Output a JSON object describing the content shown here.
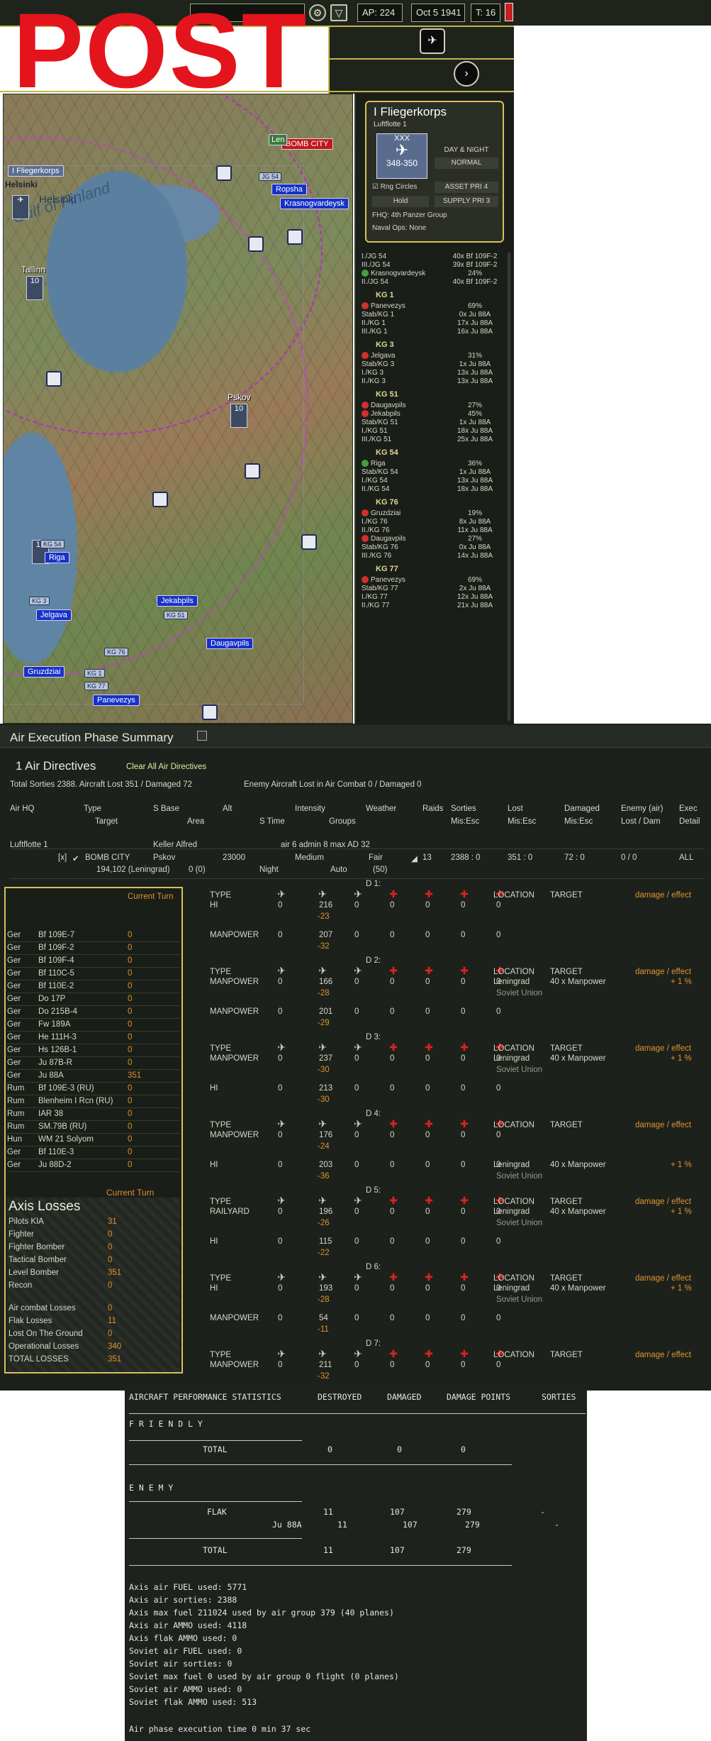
{
  "overlay": {
    "post": "POST"
  },
  "topbar": {
    "ap": "AP: 224",
    "date": "Oct 5 1941",
    "turn": "T: 16"
  },
  "map": {
    "cities": [
      "Helsinki",
      "Tallinn",
      "Pskov",
      "Riga",
      "Jelgava",
      "Jekabpils",
      "Daugavpils",
      "Gruzdziai",
      "Panevezys",
      "Ropsha",
      "Krasnogvardeysk"
    ],
    "target_label": "BOMB CITY",
    "hq_label": "I Fliegerkorps",
    "sea_label": "Gulf of Finland",
    "unit_tags": [
      "JG 54",
      "KG 54",
      "KG 3",
      "KG 51",
      "KG 76",
      "KG 1",
      "KG 77"
    ],
    "stack_values": [
      "10",
      "10",
      "10"
    ],
    "partial_label": "Len"
  },
  "hq_card": {
    "name": "I Fliegerkorps",
    "parent": "Luftflotte 1",
    "strength": "348-350",
    "mode": "DAY & NIGHT",
    "setting": "NORMAL",
    "rng": "Rng Circles",
    "asset": "ASSET PRI 4",
    "hold": "Hold",
    "supply": "SUPPLY PRI 3",
    "fhq": "FHQ: 4th Panzer Group",
    "naval": "Naval Ops: None"
  },
  "side_list": {
    "lines": [
      {
        "l": "I./JG 54",
        "r": "40x Bf 109F-2"
      },
      {
        "l": "III./JG 54",
        "r": "39x Bf 109F-2"
      },
      {
        "l": "Krasnogvardeysk",
        "r": "24%",
        "ck": "g"
      },
      {
        "l": "II./JG 54",
        "r": "40x Bf 109F-2"
      },
      {
        "g": "KG 1"
      },
      {
        "l": "Panevezys",
        "r": "69%",
        "ck": "r"
      },
      {
        "l": "Stab/KG 1",
        "r": "0x Ju 88A"
      },
      {
        "l": "II./KG 1",
        "r": "17x Ju 88A"
      },
      {
        "l": "III./KG 1",
        "r": "16x Ju 88A"
      },
      {
        "g": "KG 3"
      },
      {
        "l": "Jelgava",
        "r": "31%",
        "ck": "r"
      },
      {
        "l": "Stab/KG 3",
        "r": "1x Ju 88A"
      },
      {
        "l": "I./KG 3",
        "r": "13x Ju 88A"
      },
      {
        "l": "II./KG 3",
        "r": "13x Ju 88A"
      },
      {
        "g": "KG 51"
      },
      {
        "l": "Daugavpils",
        "r": "27%",
        "ck": "r"
      },
      {
        "l": "Jekabpils",
        "r": "45%",
        "ck": "r"
      },
      {
        "l": "Stab/KG 51",
        "r": "1x Ju 88A"
      },
      {
        "l": "I./KG 51",
        "r": "18x Ju 88A"
      },
      {
        "l": "III./KG 51",
        "r": "25x Ju 88A"
      },
      {
        "g": "KG 54"
      },
      {
        "l": "Riga",
        "r": "36%",
        "ck": "g"
      },
      {
        "l": "Stab/KG 54",
        "r": "1x Ju 88A"
      },
      {
        "l": "I./KG 54",
        "r": "13x Ju 88A"
      },
      {
        "l": "II./KG 54",
        "r": "18x Ju 88A"
      },
      {
        "g": "KG 76"
      },
      {
        "l": "Gruzdziai",
        "r": "19%",
        "ck": "r"
      },
      {
        "l": "I./KG 76",
        "r": "8x Ju 88A"
      },
      {
        "l": "II./KG 76",
        "r": "11x Ju 88A"
      },
      {
        "l": "Daugavpils",
        "r": "27%",
        "ck": "r"
      },
      {
        "l": "Stab/KG 76",
        "r": "0x Ju 88A"
      },
      {
        "l": "III./KG 76",
        "r": "14x Ju 88A"
      },
      {
        "g": "KG 77"
      },
      {
        "l": "Panevezys",
        "r": "69%",
        "ck": "r"
      },
      {
        "l": "Stab/KG 77",
        "r": "2x Ju 88A"
      },
      {
        "l": "I./KG 77",
        "r": "12x Ju 88A"
      },
      {
        "l": "II./KG 77",
        "r": "21x Ju 88A"
      }
    ]
  },
  "summary": {
    "title": "Air Execution Phase Summary",
    "directives": "1 Air Directives",
    "clear_all": "Clear All Air Directives",
    "totals": "Total Sorties 2388. Aircraft Lost 351 / Damaged 72",
    "enemy_lost": "Enemy Aircraft Lost in Air Combat 0 / Damaged 0",
    "col_headers": [
      "Air HQ",
      "Type",
      "S Base",
      "Alt",
      "Intensity",
      "Weather",
      "Raids",
      "Sorties",
      "Lost",
      "Damaged",
      "Enemy (air)",
      "Exec"
    ],
    "col_sub": [
      "Target",
      "Area",
      "S Time",
      "Groups",
      "Mis:Esc",
      "Mis:Esc",
      "Mis:Esc",
      "Lost / Dam",
      "Detail"
    ],
    "hq_row": {
      "name": "Luftflotte 1",
      "commander": "Keller Alfred",
      "stats": "air 6   admin 8   max AD 32"
    },
    "directive_row": {
      "check": "[x]",
      "type": "BOMB CITY",
      "base": "Pskov",
      "alt": "23000",
      "intensity": "Medium",
      "weather": "Fair",
      "raids": "13",
      "sorties": "2388 : 0",
      "lost": "351 : 0",
      "damaged": "72 : 0",
      "enemy": "0 / 0",
      "detail": "ALL",
      "target": "194,102 (Leningrad)",
      "area": "0 (0)",
      "time": "Night",
      "groups": "Auto",
      "groups_n": "(50)"
    }
  },
  "losses_panel": {
    "current_turn": "Current Turn",
    "rows": [
      {
        "n": "Ger",
        "t": "Bf 109E-7",
        "v": "0"
      },
      {
        "n": "Ger",
        "t": "Bf 109F-2",
        "v": "0"
      },
      {
        "n": "Ger",
        "t": "Bf 109F-4",
        "v": "0"
      },
      {
        "n": "Ger",
        "t": "Bf 110C-5",
        "v": "0"
      },
      {
        "n": "Ger",
        "t": "Bf 110E-2",
        "v": "0"
      },
      {
        "n": "Ger",
        "t": "Do 17P",
        "v": "0"
      },
      {
        "n": "Ger",
        "t": "Do 215B-4",
        "v": "0"
      },
      {
        "n": "Ger",
        "t": "Fw 189A",
        "v": "0"
      },
      {
        "n": "Ger",
        "t": "He 111H-3",
        "v": "0"
      },
      {
        "n": "Ger",
        "t": "Hs 126B-1",
        "v": "0"
      },
      {
        "n": "Ger",
        "t": "Ju 87B-R",
        "v": "0"
      },
      {
        "n": "Ger",
        "t": "Ju 88A",
        "v": "351"
      },
      {
        "n": "Rum",
        "t": "Bf 109E-3 (RU)",
        "v": "0"
      },
      {
        "n": "Rum",
        "t": "Blenheim I Rcn (RU)",
        "v": "0"
      },
      {
        "n": "Rum",
        "t": "IAR 38",
        "v": "0"
      },
      {
        "n": "Rum",
        "t": "SM.79B (RU)",
        "v": "0"
      },
      {
        "n": "Hun",
        "t": "WM 21 Solyom",
        "v": "0"
      },
      {
        "n": "Ger",
        "t": "Bf 110E-3",
        "v": "0"
      },
      {
        "n": "Ger",
        "t": "Ju 88D-2",
        "v": "0"
      }
    ],
    "axis_title": "Axis Losses",
    "axis_current": "Current Turn",
    "axis_rows": [
      {
        "k": "Pilots KIA",
        "v": "31"
      },
      {
        "k": "Fighter",
        "v": "0"
      },
      {
        "k": "Fighter Bomber",
        "v": "0"
      },
      {
        "k": "Tactical Bomber",
        "v": "0"
      },
      {
        "k": "Level Bomber",
        "v": "351"
      },
      {
        "k": "Recon",
        "v": "0"
      }
    ],
    "axis_rows2": [
      {
        "k": "Air combat Losses",
        "v": "0"
      },
      {
        "k": "Flak Losses",
        "v": "11"
      },
      {
        "k": "Lost On The Ground",
        "v": "0"
      },
      {
        "k": "Operational Losses",
        "v": "340"
      },
      {
        "k": "TOTAL LOSSES",
        "v": "351"
      }
    ]
  },
  "days": [
    {
      "d": "D 1:",
      "rows": [
        {
          "type": "HI",
          "v": [
            "0",
            "216",
            "0",
            "0",
            "0",
            "0",
            "0"
          ],
          "delta": "-23",
          "loc": "",
          "tgt": "",
          "eff": ""
        },
        {
          "type": "MANPOWER",
          "v": [
            "0",
            "207",
            "0",
            "0",
            "0",
            "0",
            "0"
          ],
          "delta": "-32",
          "loc": "",
          "tgt": "",
          "eff": ""
        }
      ]
    },
    {
      "d": "D 2:",
      "rows": [
        {
          "type": "MANPOWER",
          "v": [
            "0",
            "166",
            "0",
            "0",
            "0",
            "0",
            "0"
          ],
          "delta": "-28",
          "loc": "Leningrad",
          "tgt": "40 x Manpower",
          "eff": "+ 1 %",
          "country": "Soviet Union"
        },
        {
          "type": "MANPOWER",
          "v": [
            "0",
            "201",
            "0",
            "0",
            "0",
            "0",
            "0"
          ],
          "delta": "-29",
          "loc": "",
          "tgt": "",
          "eff": ""
        }
      ]
    },
    {
      "d": "D 3:",
      "rows": [
        {
          "type": "MANPOWER",
          "v": [
            "0",
            "237",
            "0",
            "0",
            "0",
            "0",
            "0"
          ],
          "delta": "-30",
          "loc": "Leningrad",
          "tgt": "40 x Manpower",
          "eff": "+ 1 %",
          "country": "Soviet Union"
        },
        {
          "type": "HI",
          "v": [
            "0",
            "213",
            "0",
            "0",
            "0",
            "0",
            "0"
          ],
          "delta": "-30",
          "loc": "",
          "tgt": "",
          "eff": ""
        }
      ]
    },
    {
      "d": "D 4:",
      "rows": [
        {
          "type": "MANPOWER",
          "v": [
            "0",
            "176",
            "0",
            "0",
            "0",
            "0",
            "0"
          ],
          "delta": "-24",
          "loc": "",
          "tgt": "",
          "eff": ""
        },
        {
          "type": "HI",
          "v": [
            "0",
            "203",
            "0",
            "0",
            "0",
            "0",
            "0"
          ],
          "delta": "-36",
          "loc": "Leningrad",
          "tgt": "40 x Manpower",
          "eff": "+ 1 %",
          "country": "Soviet Union"
        }
      ]
    },
    {
      "d": "D 5:",
      "rows": [
        {
          "type": "RAILYARD",
          "v": [
            "0",
            "196",
            "0",
            "0",
            "0",
            "0",
            "0"
          ],
          "delta": "-26",
          "loc": "Leningrad",
          "tgt": "40 x Manpower",
          "eff": "+ 1 %",
          "country": "Soviet Union"
        },
        {
          "type": "HI",
          "v": [
            "0",
            "115",
            "0",
            "0",
            "0",
            "0",
            "0"
          ],
          "delta": "-22",
          "loc": "",
          "tgt": "",
          "eff": ""
        }
      ]
    },
    {
      "d": "D 6:",
      "rows": [
        {
          "type": "HI",
          "v": [
            "0",
            "193",
            "0",
            "0",
            "0",
            "0",
            "0"
          ],
          "delta": "-28",
          "loc": "Leningrad",
          "tgt": "40 x Manpower",
          "eff": "+ 1 %",
          "country": "Soviet Union"
        },
        {
          "type": "MANPOWER",
          "v": [
            "0",
            "54",
            "0",
            "0",
            "0",
            "0",
            "0"
          ],
          "delta": "-11",
          "loc": "",
          "tgt": "",
          "eff": ""
        }
      ]
    },
    {
      "d": "D 7:",
      "rows": [
        {
          "type": "MANPOWER",
          "v": [
            "0",
            "211",
            "0",
            "0",
            "0",
            "0",
            "0"
          ],
          "delta": "-32",
          "loc": "",
          "tgt": "",
          "eff": ""
        }
      ]
    }
  ],
  "day_labels": {
    "type": "TYPE",
    "location": "LOCATION",
    "target": "TARGET",
    "effect": "damage / effect"
  },
  "report": {
    "header": [
      "AIRCRAFT PERFORMANCE STATISTICS",
      "DESTROYED",
      "DAMAGED",
      "DAMAGE POINTS",
      "SORTIES"
    ],
    "friendly": "F R I E N D L Y",
    "friendly_total": {
      "label": "TOTAL",
      "destroyed": "0",
      "damaged": "0",
      "points": "0"
    },
    "enemy": "E N E M Y",
    "flak": {
      "label": "FLAK",
      "destroyed": "11",
      "damaged": "107",
      "points": "279",
      "sorties": "-"
    },
    "ju88": {
      "label": "Ju 88A",
      "destroyed": "11",
      "damaged": "107",
      "points": "279",
      "sorties": "-"
    },
    "enemy_total": {
      "label": "TOTAL",
      "destroyed": "11",
      "damaged": "107",
      "points": "279"
    },
    "log": [
      "Axis air FUEL used: 5771",
      "Axis air sorties: 2388",
      "Axis max fuel 211024 used by air group 379 (40 planes)",
      "Axis air AMMO used: 4118",
      "Axis flak AMMO used: 0",
      "Soviet air FUEL used: 0",
      "Soviet air sorties: 0",
      "Soviet max fuel 0 used by air group 0 flight (0 planes)",
      "Soviet air AMMO used: 0",
      "Soviet flak AMMO used: 513"
    ],
    "exec_time": "Air phase execution time 0 min 37 sec"
  }
}
